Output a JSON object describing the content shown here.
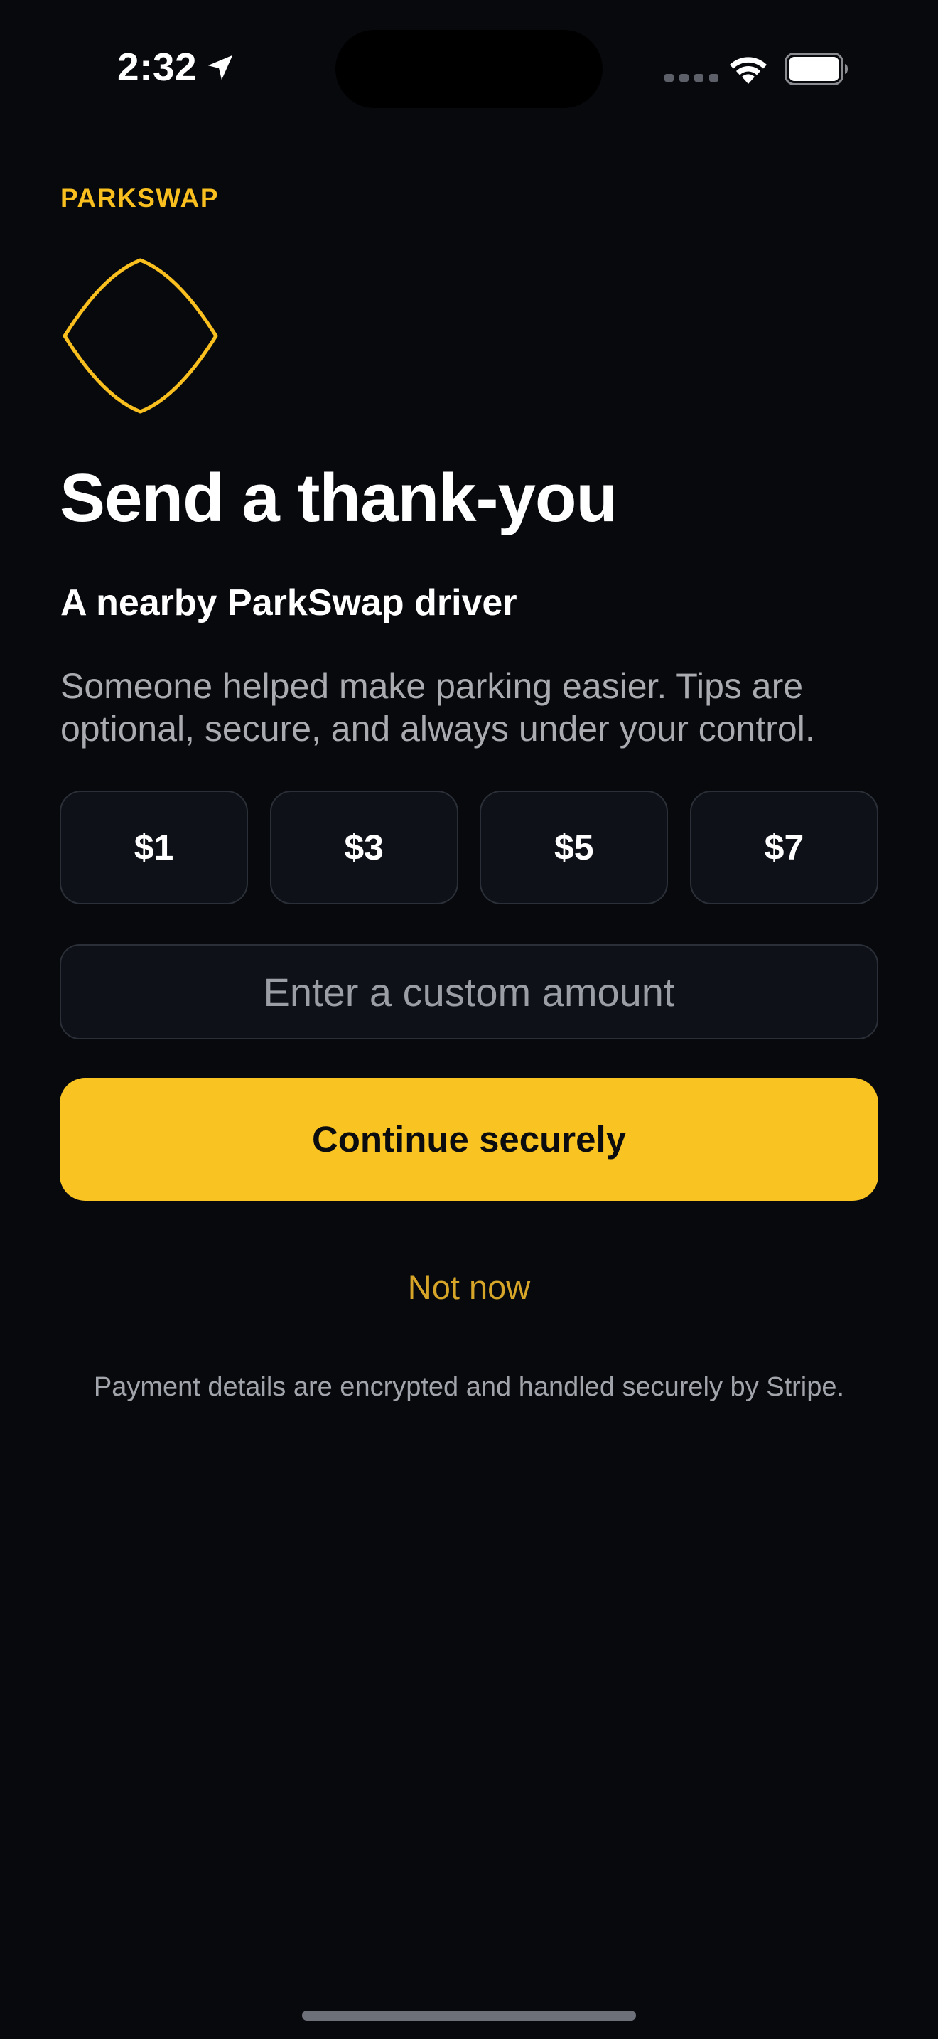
{
  "status_bar": {
    "time": "2:32",
    "location_icon": "location-arrow-icon",
    "wifi_icon": "wifi-icon",
    "battery_icon": "battery-icon",
    "signal_icon": "cellular-signal-icon"
  },
  "brand": {
    "name": "PARKSWAP",
    "accent_color": "#f9bf1f",
    "logo_icon": "parkswap-logo-icon"
  },
  "header": {
    "title": "Send a thank-you",
    "subtitle": "A nearby ParkSwap driver",
    "description": "Someone helped make parking easier. Tips are optional, secure, and always under your control."
  },
  "tip_options": [
    {
      "label": "$1"
    },
    {
      "label": "$3"
    },
    {
      "label": "$5"
    },
    {
      "label": "$7"
    }
  ],
  "custom_amount": {
    "placeholder": "Enter a custom amount",
    "value": ""
  },
  "actions": {
    "continue_label": "Continue securely",
    "continue_color": "#f9c322",
    "not_now_label": "Not now"
  },
  "footer": {
    "security_note": "Payment details are encrypted and handled securely by Stripe."
  },
  "colors": {
    "background": "#07090d",
    "card": "#0e1118",
    "card_border": "#2b2f37"
  }
}
